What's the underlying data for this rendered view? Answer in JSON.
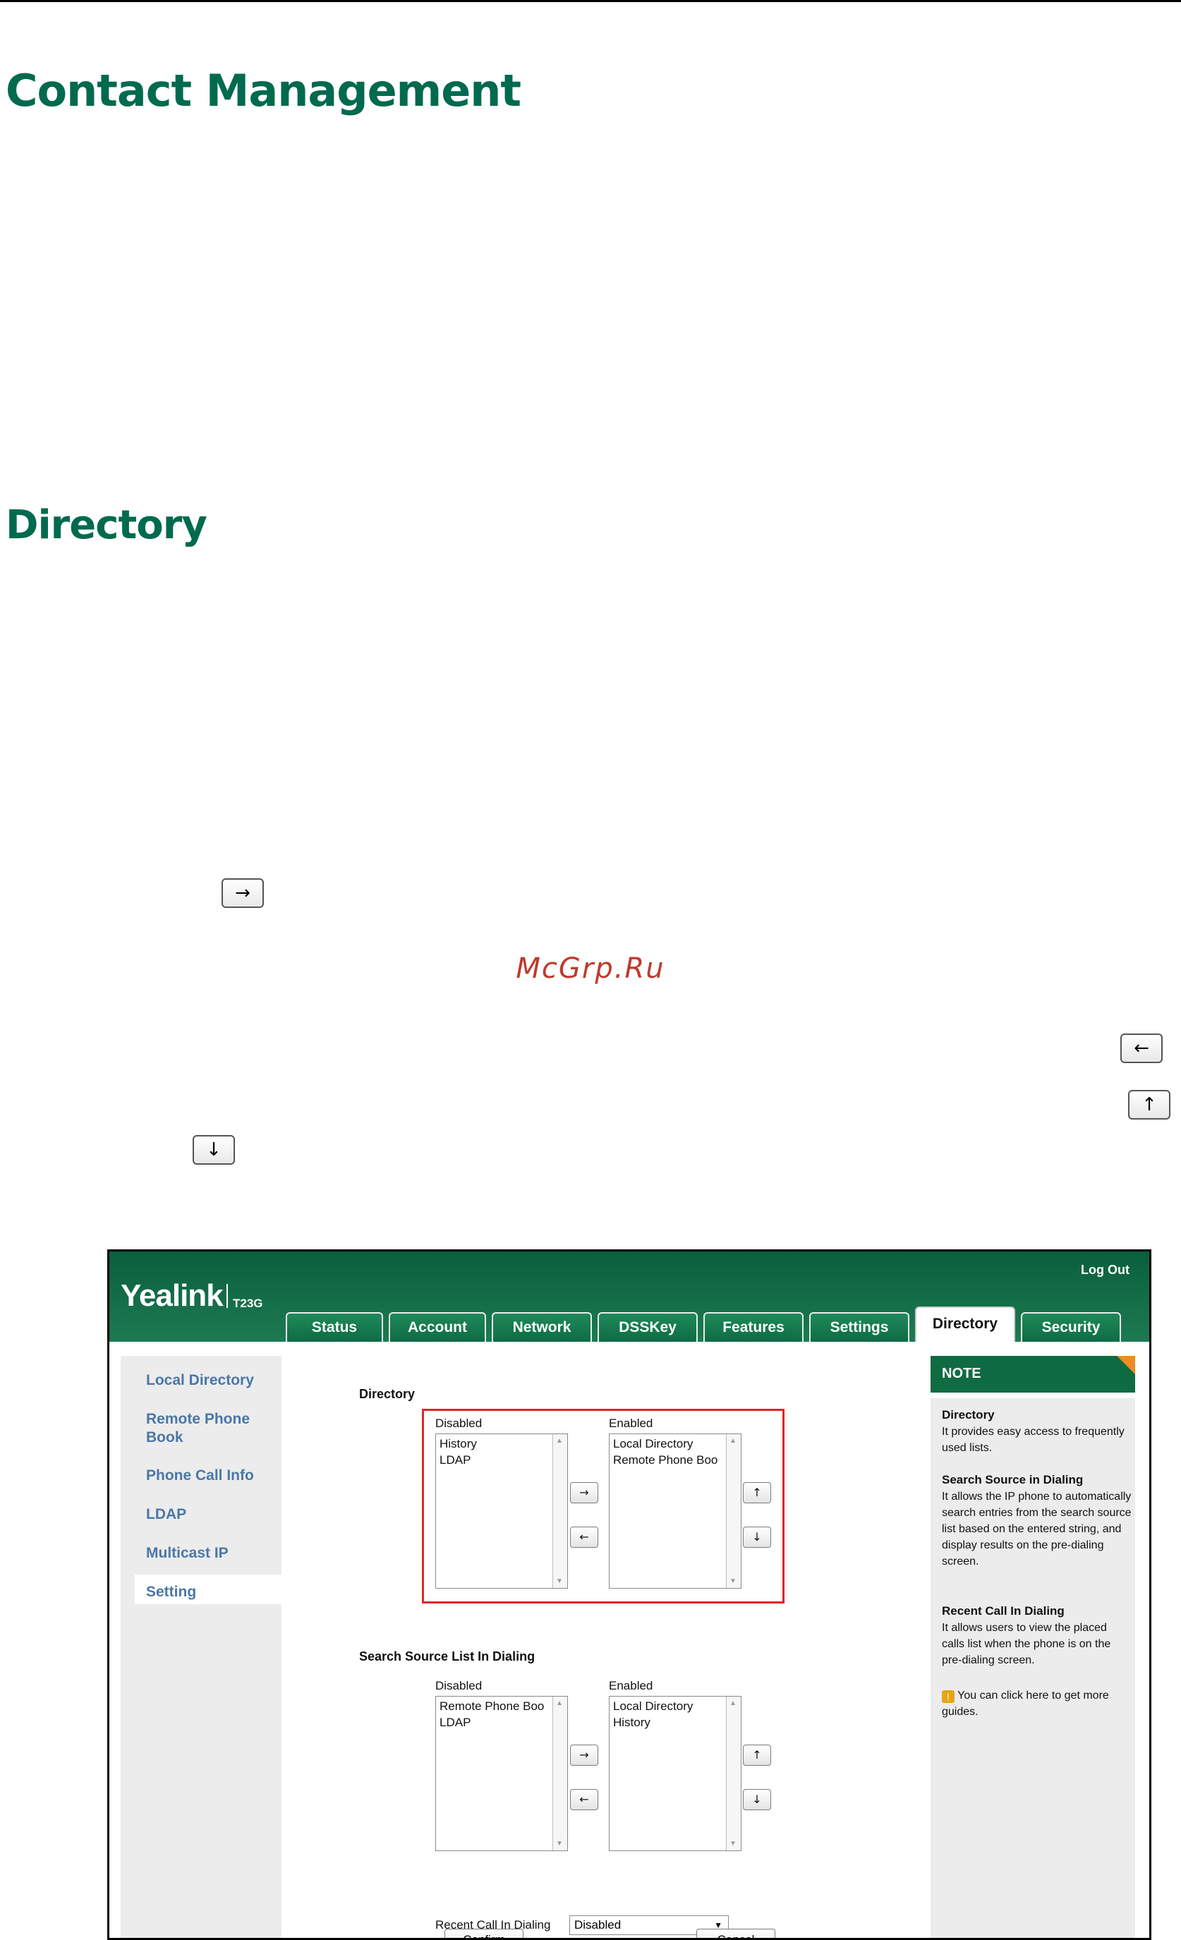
{
  "doc": {
    "heading_main": "Contact Management",
    "heading_section": "Directory",
    "watermark": "McGrp.Ru",
    "inline_buttons": {
      "right": "→",
      "left": "←",
      "up": "↑",
      "down": "↓"
    }
  },
  "screenshot": {
    "brand": "Yealink",
    "model": "T23G",
    "logout": "Log Out",
    "tabs": [
      "Status",
      "Account",
      "Network",
      "DSSKey",
      "Features",
      "Settings",
      "Directory",
      "Security"
    ],
    "active_tab": "Directory",
    "sidebar": [
      "Local Directory",
      "Remote Phone Book",
      "Phone Call Info",
      "LDAP",
      "Multicast IP",
      "Setting"
    ],
    "active_sidebar": "Setting",
    "directory": {
      "title": "Directory",
      "disabled_label": "Disabled",
      "enabled_label": "Enabled",
      "disabled_items": [
        "History",
        "LDAP"
      ],
      "enabled_items": [
        "Local Directory",
        "Remote Phone Boo"
      ]
    },
    "search_source": {
      "title": "Search Source List In Dialing",
      "disabled_label": "Disabled",
      "enabled_label": "Enabled",
      "disabled_items": [
        "Remote Phone Boo",
        "LDAP"
      ],
      "enabled_items": [
        "Local Directory",
        "History"
      ]
    },
    "recent_call": {
      "label": "Recent Call In Dialing",
      "value": "Disabled"
    },
    "confirm": "Confirm",
    "cancel": "Cancel",
    "note": {
      "header": "NOTE",
      "items": [
        {
          "title": "Directory",
          "text": "It provides easy access to frequently used lists."
        },
        {
          "title": "Search Source in Dialing",
          "text": "It allows the IP phone to automatically search entries from the search source list based on the entered string, and display results on the pre-dialing screen."
        },
        {
          "title": "Recent Call In Dialing",
          "text": "It allows users to view the placed calls list when the phone is on the pre-dialing screen."
        }
      ],
      "guide": "You can click here to get more guides."
    }
  }
}
